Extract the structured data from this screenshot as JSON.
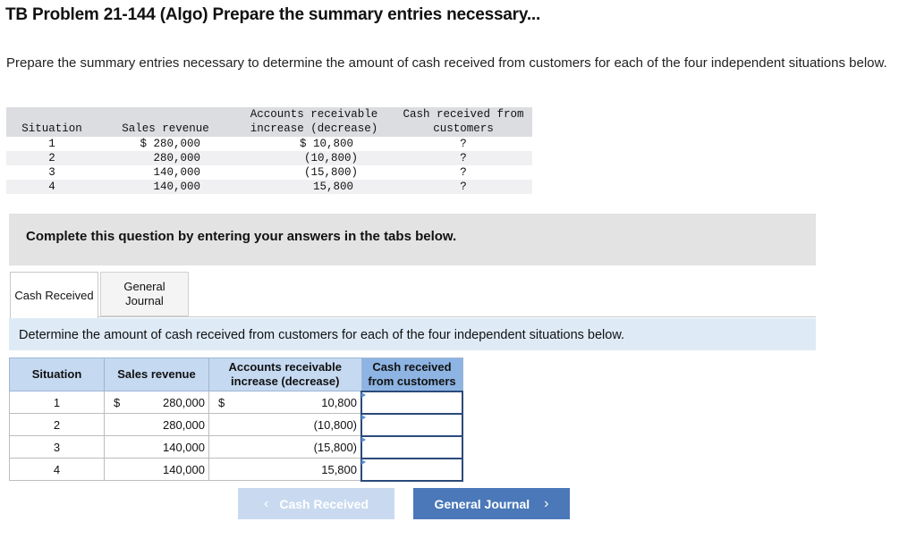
{
  "header": {
    "title": "TB Problem 21-144 (Algo) Prepare the summary entries necessary..."
  },
  "prompt": "Prepare the summary entries necessary to determine the amount of cash received from customers for each of the four independent situations below.",
  "reference_table": {
    "headers": {
      "situation": "Situation",
      "sales": "Sales revenue",
      "ar_line1": "Accounts receivable",
      "ar_line2": "increase (decrease)",
      "cash_line1": "Cash received from",
      "cash_line2": "customers"
    },
    "rows": [
      {
        "situation": "1",
        "sales": "$ 280,000",
        "ar": "$ 10,800",
        "cash": "?"
      },
      {
        "situation": "2",
        "sales": "280,000",
        "ar": "(10,800)",
        "cash": "?"
      },
      {
        "situation": "3",
        "sales": "140,000",
        "ar": "(15,800)",
        "cash": "?"
      },
      {
        "situation": "4",
        "sales": "140,000",
        "ar": "15,800",
        "cash": "?"
      }
    ]
  },
  "banner": "Complete this question by entering your answers in the tabs below.",
  "tabs": [
    {
      "label": "Cash Received"
    },
    {
      "label_line1": "General",
      "label_line2": "Journal"
    }
  ],
  "instruction": "Determine the amount of cash received from customers for each of the four independent situations below.",
  "answer_table": {
    "headers": {
      "situation": "Situation",
      "sales": "Sales revenue",
      "ar_line1": "Accounts receivable",
      "ar_line2": "increase (decrease)",
      "cash_line1": "Cash received",
      "cash_line2": "from customers"
    },
    "rows": [
      {
        "situation": "1",
        "sales_dollar": "$",
        "sales": "280,000",
        "ar_dollar": "$",
        "ar": "10,800",
        "cash": ""
      },
      {
        "situation": "2",
        "sales_dollar": "",
        "sales": "280,000",
        "ar_dollar": "",
        "ar": "(10,800)",
        "cash": ""
      },
      {
        "situation": "3",
        "sales_dollar": "",
        "sales": "140,000",
        "ar_dollar": "",
        "ar": "(15,800)",
        "cash": ""
      },
      {
        "situation": "4",
        "sales_dollar": "",
        "sales": "140,000",
        "ar_dollar": "",
        "ar": "15,800",
        "cash": ""
      }
    ]
  },
  "nav": {
    "prev_label": "Cash Received",
    "prev_icon": "chevron-left-icon",
    "next_label": "General Journal",
    "next_icon": "chevron-right-icon"
  }
}
